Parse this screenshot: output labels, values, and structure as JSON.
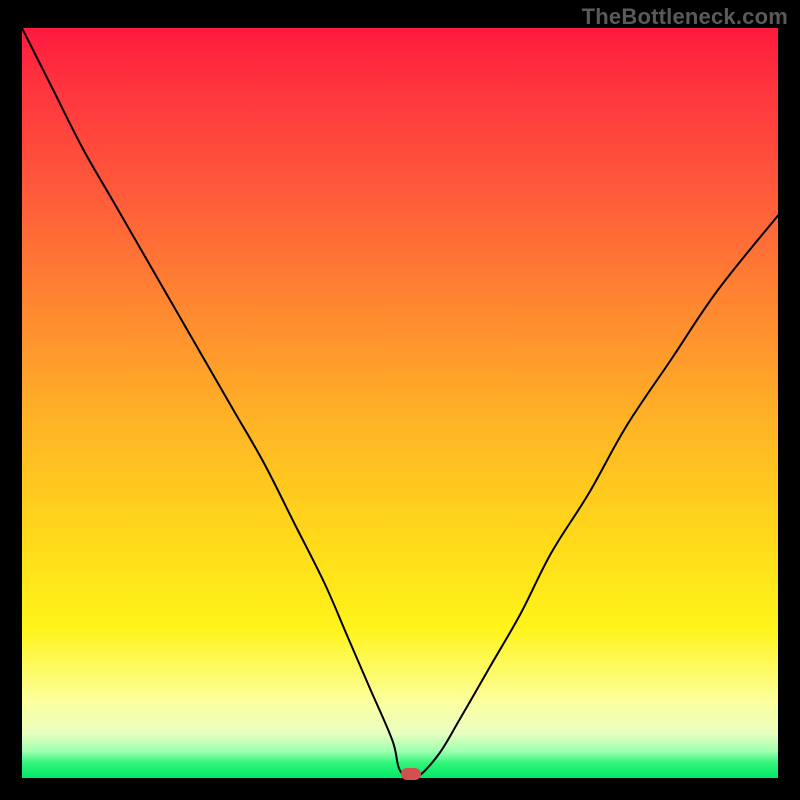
{
  "watermark": "TheBottleneck.com",
  "chart_data": {
    "type": "line",
    "title": "",
    "xlabel": "",
    "ylabel": "",
    "xlim": [
      0,
      100
    ],
    "ylim": [
      0,
      100
    ],
    "background_gradient_stops": [
      {
        "pos": 0,
        "color": "#ff1a3f"
      },
      {
        "pos": 22,
        "color": "#ff5a3a"
      },
      {
        "pos": 52,
        "color": "#ffb226"
      },
      {
        "pos": 80,
        "color": "#fff41a"
      },
      {
        "pos": 94,
        "color": "#e9ffc0"
      },
      {
        "pos": 100,
        "color": "#00e865"
      }
    ],
    "series": [
      {
        "name": "bottleneck-curve",
        "x": [
          0,
          4,
          8,
          12,
          16,
          20,
          24,
          28,
          32,
          36,
          40,
          43,
          46,
          49,
          50,
          52,
          55,
          58,
          62,
          66,
          70,
          75,
          80,
          86,
          92,
          100
        ],
        "y": [
          100,
          92,
          84,
          77,
          70,
          63,
          56,
          49,
          42,
          34,
          26,
          19,
          12,
          5,
          1,
          0,
          3,
          8,
          15,
          22,
          30,
          38,
          47,
          56,
          65,
          75
        ]
      }
    ],
    "marker": {
      "x": 51.5,
      "y": 0.5,
      "color": "#d2504f"
    },
    "flat_min_range_x": [
      49,
      53
    ]
  }
}
